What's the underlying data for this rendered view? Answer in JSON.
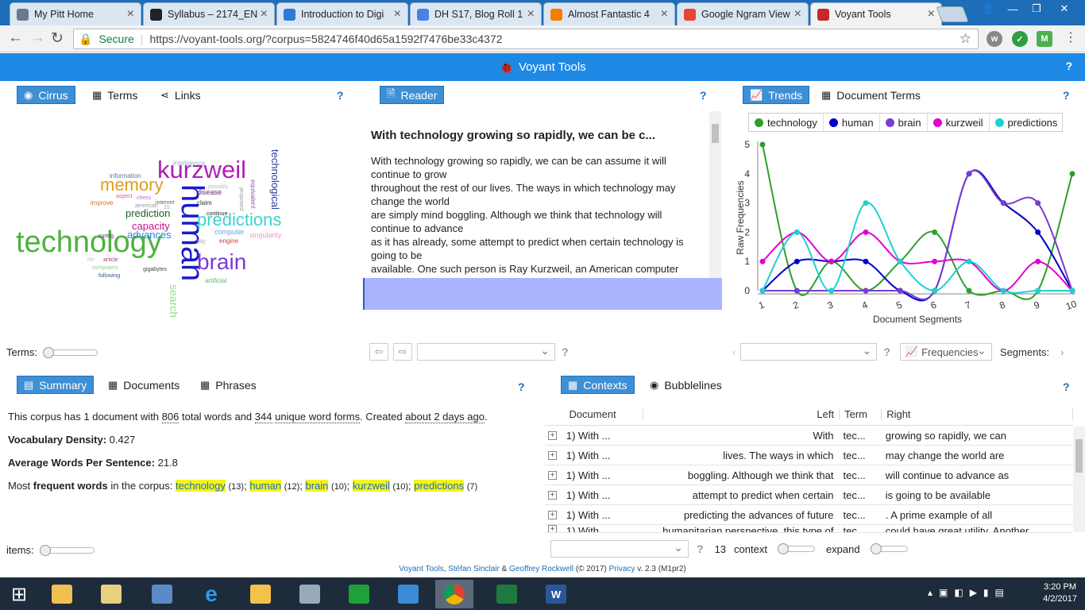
{
  "browser": {
    "tabs": [
      {
        "title": "My Pitt Home",
        "color": "#6b7a8a"
      },
      {
        "title": "Syllabus – 2174_ENG",
        "color": "#222"
      },
      {
        "title": "Introduction to Digi",
        "color": "#2a7ad6"
      },
      {
        "title": "DH S17, Blog Roll 1",
        "color": "#4a80e8"
      },
      {
        "title": "Almost Fantastic 4",
        "color": "#f57c00"
      },
      {
        "title": "Google Ngram View",
        "color": "#ea4335"
      },
      {
        "title": "Voyant Tools",
        "color": "#c62828"
      }
    ],
    "tab_close": "×",
    "back": "←",
    "forward": "→",
    "reload": "↻",
    "secure": "Secure",
    "url": "https://voyant-tools.org/?corpus=5824746f40d65a1592f7476be33c4372",
    "star": "☆"
  },
  "header": {
    "title": "Voyant Tools",
    "help": "?"
  },
  "left_panel": {
    "tabs": [
      {
        "label": "Cirrus",
        "icon": "eye-icon",
        "glyph": "◉"
      },
      {
        "label": "Terms",
        "icon": "grid-icon",
        "glyph": "▦"
      },
      {
        "label": "Links",
        "icon": "share-icon",
        "glyph": "⋖"
      }
    ],
    "help": "?",
    "terms_label": "Terms:",
    "words": [
      {
        "t": "technology",
        "c": "#4db33d"
      },
      {
        "t": "human",
        "c": "#1a1acc"
      },
      {
        "t": "kurzweil",
        "c": "#b01eb5"
      },
      {
        "t": "brain",
        "c": "#7b3bd1"
      },
      {
        "t": "memory",
        "c": "#e09c1a"
      },
      {
        "t": "predictions",
        "c": "#3ad3d3"
      },
      {
        "t": "prediction",
        "c": "#1d5e1d"
      },
      {
        "t": "capacity",
        "c": "#c0188b"
      },
      {
        "t": "advances",
        "c": "#1e88e5"
      },
      {
        "t": "technological",
        "c": "#2c3e9a"
      },
      {
        "t": "search",
        "c": "#8be08b"
      },
      {
        "t": "information",
        "c": "#5a7a9a"
      },
      {
        "t": "intelligence",
        "c": "#9ab0d0"
      },
      {
        "t": "singularity",
        "c": "#e0a0c0"
      },
      {
        "t": "computer",
        "c": "#6aa0e0"
      },
      {
        "t": "artificial",
        "c": "#5bbf5b"
      },
      {
        "t": "disease",
        "c": "#6b2a7a"
      },
      {
        "t": "claim",
        "c": "#333"
      },
      {
        "t": "continue",
        "c": "#222"
      },
      {
        "t": "engine",
        "c": "#c04040"
      },
      {
        "t": "improve",
        "c": "#d07030"
      },
      {
        "t": "curing",
        "c": "#5a2a7a"
      },
      {
        "t": "gigabytes",
        "c": "#444"
      },
      {
        "t": "following",
        "c": "#3a5a8a"
      },
      {
        "t": "computers",
        "c": "#8bd08b"
      },
      {
        "t": "article",
        "c": "#a04080"
      },
      {
        "t": "life",
        "c": "#b0d0b0"
      },
      {
        "t": "chess",
        "c": "#b070d0"
      },
      {
        "t": "american",
        "c": "#999"
      },
      {
        "t": "aspect",
        "c": "#e060a0"
      },
      {
        "t": "internet",
        "c": "#666"
      },
      {
        "t": "ray",
        "c": "#aaa"
      },
      {
        "t": "15",
        "c": "#aaa"
      },
      {
        "t": "equivalent",
        "c": "#8a5ab0"
      },
      {
        "t": "possibly",
        "c": "#bbb"
      },
      {
        "t": "proposed",
        "c": "#999"
      }
    ]
  },
  "reader": {
    "tab": "Reader",
    "help": "?",
    "title": "With technology growing so rapidly, we can be c...",
    "lines": [
      "With technology growing so rapidly, we can be can assume it will",
      "continue to grow",
      "throughout the rest of our lives. The ways in which technology may",
      "change the world",
      "are simply mind boggling. Although we think that technology will",
      "continue to advance",
      "as it has already, some attempt to predict when certain technology is",
      "going to be",
      "available. One such person is Ray Kurzweil, an American computer"
    ],
    "prev": "⇦",
    "next": "⇨"
  },
  "trends": {
    "tabs": [
      {
        "label": "Trends",
        "glyph": "📈"
      },
      {
        "label": "Document Terms",
        "glyph": "▦"
      }
    ],
    "help": "?",
    "frequencies": "Frequencies",
    "segments": "Segments:"
  },
  "chart_data": {
    "type": "line",
    "x": [
      1,
      2,
      3,
      4,
      5,
      6,
      7,
      8,
      9,
      10
    ],
    "xlabel": "Document Segments",
    "ylabel": "Raw Frequencies",
    "ylim": [
      0,
      5
    ],
    "yticks": [
      0,
      1,
      2,
      3,
      4,
      5
    ],
    "legend_position": "top",
    "series": [
      {
        "name": "technology",
        "color": "#2ca02c",
        "values": [
          5,
          0,
          1,
          0,
          1,
          2,
          0,
          0,
          0,
          4
        ]
      },
      {
        "name": "human",
        "color": "#0000cc",
        "values": [
          0,
          1,
          1,
          1,
          0,
          0,
          4,
          3,
          2,
          0
        ]
      },
      {
        "name": "brain",
        "color": "#7a3bd1",
        "values": [
          0,
          0,
          0,
          0,
          0,
          0,
          4,
          3,
          3,
          0
        ]
      },
      {
        "name": "kurzweil",
        "color": "#e000d0",
        "values": [
          1,
          2,
          1,
          2,
          1,
          1,
          1,
          0,
          1,
          0
        ]
      },
      {
        "name": "predictions",
        "color": "#20d0d0",
        "values": [
          0,
          2,
          0,
          3,
          1,
          0,
          1,
          0,
          0,
          0
        ]
      }
    ]
  },
  "summary": {
    "tabs": [
      {
        "label": "Summary",
        "glyph": "▤"
      },
      {
        "label": "Documents",
        "glyph": "▦"
      },
      {
        "label": "Phrases",
        "glyph": "▦"
      }
    ],
    "help": "?",
    "line1_a": "This corpus has 1 document with",
    "line1_total": "806",
    "line1_b": "total words and",
    "line1_unique": "344",
    "line1_c": "unique word forms",
    "line1_d": ". Created",
    "line1_ago": "about 2 days ago",
    "line1_e": ".",
    "density_label": "Vocabulary Density:",
    "density_value": "0.427",
    "avg_label": "Average Words Per Sentence:",
    "avg_value": "21.8",
    "freq_a": "Most",
    "freq_b": "frequent words",
    "freq_c": "in the corpus:",
    "freq_words": [
      {
        "w": "technology",
        "n": "(13)"
      },
      {
        "w": "human",
        "n": "(12)"
      },
      {
        "w": "brain",
        "n": "(10)"
      },
      {
        "w": "kurzweil",
        "n": "(10)"
      },
      {
        "w": "predictions",
        "n": "(7)"
      }
    ],
    "items_label": "items:"
  },
  "contexts": {
    "tabs": [
      {
        "label": "Contexts",
        "glyph": "▦"
      },
      {
        "label": "Bubblelines",
        "glyph": "◉"
      }
    ],
    "help": "?",
    "columns": [
      "Document",
      "Left",
      "Term",
      "Right"
    ],
    "rows": [
      {
        "doc": "1) With ...",
        "left": "With",
        "term": "tec...",
        "right": "growing so rapidly, we can"
      },
      {
        "doc": "1) With ...",
        "left": "lives. The ways in which",
        "term": "tec...",
        "right": "may change the world are"
      },
      {
        "doc": "1) With ...",
        "left": "boggling. Although we think that",
        "term": "tec...",
        "right": "will continue to advance as"
      },
      {
        "doc": "1) With ...",
        "left": "attempt to predict when certain",
        "term": "tec...",
        "right": "is going to be available"
      },
      {
        "doc": "1) With ...",
        "left": "predicting the advances of future",
        "term": "tec...",
        "right": ". A prime example of all"
      },
      {
        "doc": "1) With ...",
        "left": "humanitarian perspective, this type of",
        "term": "tec...",
        "right": "could have great utility. Another"
      }
    ],
    "count": "13",
    "context_label": "context",
    "expand_label": "expand"
  },
  "footer": {
    "a": "Voyant Tools",
    "b": ", ",
    "c": "Stéfan Sinclair",
    "d": " & ",
    "e": "Geoffrey Rockwell",
    "f": " (© 2017) ",
    "g": "Privacy",
    "h": " v. 2.3 (M1pr2)"
  },
  "taskbar": {
    "time": "3:20 PM",
    "date": "4/2/2017"
  }
}
